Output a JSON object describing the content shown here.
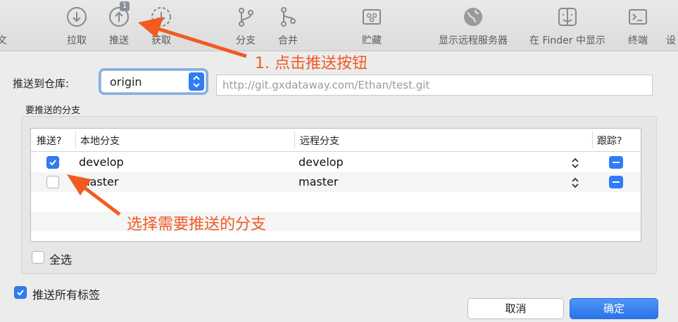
{
  "toolbar": {
    "items": [
      {
        "label": "文",
        "icon": "history-icon"
      },
      {
        "label": "拉取",
        "icon": "pull-icon"
      },
      {
        "label": "推送",
        "icon": "push-icon",
        "badge": "1"
      },
      {
        "label": "获取",
        "icon": "fetch-icon"
      },
      {
        "label": "分支",
        "icon": "branch-icon"
      },
      {
        "label": "合并",
        "icon": "merge-icon"
      },
      {
        "label": "贮藏",
        "icon": "stash-icon"
      },
      {
        "label": "显示远程服务器",
        "icon": "globe-icon"
      },
      {
        "label": "在 Finder 中显示",
        "icon": "finder-icon"
      },
      {
        "label": "终端",
        "icon": "terminal-icon"
      },
      {
        "label": "设",
        "icon": "settings-icon"
      }
    ]
  },
  "form": {
    "repo_label": "推送到仓库:",
    "repo_value": "origin",
    "url_placeholder": "http://git.gxdataway.com/Ethan/test.git",
    "branches_label": "要推送的分支"
  },
  "table": {
    "headers": {
      "push": "推送?",
      "local": "本地分支",
      "remote": "远程分支",
      "track": "跟踪?"
    },
    "rows": [
      {
        "checked": true,
        "local": "develop",
        "remote": "develop"
      },
      {
        "checked": false,
        "local": "master",
        "remote": "master"
      }
    ]
  },
  "select_all": {
    "label": "全选",
    "checked": false
  },
  "push_all_tags": {
    "label": "推送所有标签",
    "checked": true
  },
  "buttons": {
    "cancel": "取消",
    "ok": "确定"
  },
  "annotations": {
    "step1": "1. 点击推送按钮",
    "step2": "选择需要推送的分支"
  },
  "colors": {
    "accent": "#2f7cf6",
    "annotation": "#f25a22"
  }
}
